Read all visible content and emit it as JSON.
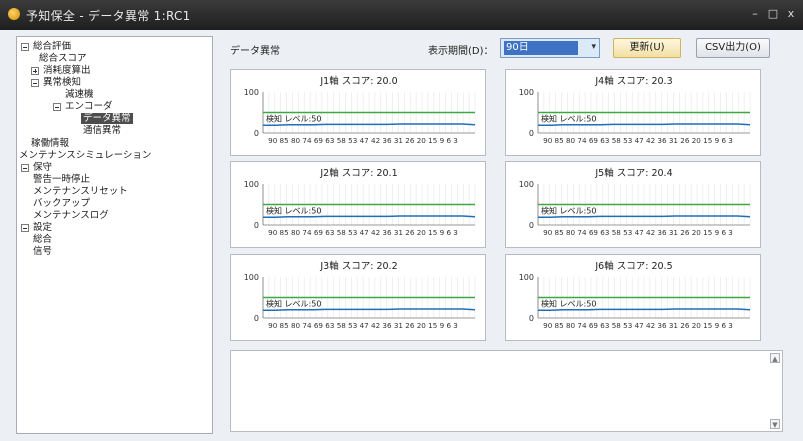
{
  "window": {
    "title": "予知保全 - データ異常 1:RC1",
    "minimize": "–",
    "maximize": "□",
    "close": "x"
  },
  "sidebar": {
    "items": [
      {
        "label": "総合評価",
        "toggle": "minus"
      },
      {
        "label": "総合スコア",
        "toggle": "none"
      },
      {
        "label": "消耗度算出",
        "toggle": "plus"
      },
      {
        "label": "異常検知",
        "toggle": "minus"
      },
      {
        "label": "減速機",
        "toggle": "none"
      },
      {
        "label": "エンコーダ",
        "toggle": "minus"
      },
      {
        "label": "データ異常",
        "toggle": "none",
        "selected": true
      },
      {
        "label": "通信異常",
        "toggle": "none"
      },
      {
        "label": "稼働情報",
        "toggle": "none"
      },
      {
        "label": "メンテナンスシミュレーション",
        "toggle": "none"
      },
      {
        "label": "保守",
        "toggle": "minus"
      },
      {
        "label": "警告一時停止",
        "toggle": "none"
      },
      {
        "label": "メンテナンスリセット",
        "toggle": "none"
      },
      {
        "label": "バックアップ",
        "toggle": "none"
      },
      {
        "label": "メンテナンスログ",
        "toggle": "none"
      },
      {
        "label": "設定",
        "toggle": "minus"
      },
      {
        "label": "総合",
        "toggle": "none"
      },
      {
        "label": "信号",
        "toggle": "none"
      }
    ]
  },
  "main": {
    "title": "データ異常",
    "period_label": "表示期間(D)：",
    "period_value": "90日",
    "update_button": "更新(U)",
    "csv_button": "CSV出力(O)"
  },
  "chart_data": [
    {
      "type": "line",
      "title": "J1軸 スコア: 20.0",
      "ylim": [
        0,
        100
      ],
      "y_ticks": [
        "100",
        "0"
      ],
      "x_tick_labels": "90 85 80 74 69 63 58 53 47 42 36 31 26 20 15  9 6 3",
      "threshold_label": "検知 レベル:50",
      "threshold": 50,
      "series_color": "#1f6fb7",
      "threshold_color": "#3aa845",
      "series": [
        {
          "values": [
            19,
            19,
            20,
            20,
            20,
            21,
            21,
            21,
            21,
            21,
            21,
            22,
            22,
            22,
            22,
            22,
            22,
            20
          ]
        }
      ]
    },
    {
      "type": "line",
      "title": "J4軸 スコア: 20.3",
      "ylim": [
        0,
        100
      ],
      "y_ticks": [
        "100",
        "0"
      ],
      "x_tick_labels": "90 85 80 74 69 63 58 53 47 42 36 31 26 20 15  9 6 3",
      "threshold_label": "検知 レベル:50",
      "threshold": 50,
      "series_color": "#1f6fb7",
      "threshold_color": "#3aa845",
      "series": [
        {
          "values": [
            19,
            19,
            20,
            20,
            20,
            20,
            21,
            21,
            21,
            21,
            21,
            22,
            22,
            22,
            22,
            22,
            22,
            20
          ]
        }
      ]
    },
    {
      "type": "line",
      "title": "J2軸 スコア: 20.1",
      "ylim": [
        0,
        100
      ],
      "y_ticks": [
        "100",
        "0"
      ],
      "x_tick_labels": "90 85 80 74 69 63 58 53 47 42 36 31 26 20 15  9 6 3",
      "threshold_label": "検知 レベル:50",
      "threshold": 50,
      "series_color": "#1f6fb7",
      "threshold_color": "#3aa845",
      "series": [
        {
          "values": [
            19,
            19,
            20,
            20,
            20,
            21,
            21,
            21,
            21,
            21,
            21,
            22,
            22,
            22,
            22,
            22,
            22,
            20
          ]
        }
      ]
    },
    {
      "type": "line",
      "title": "J5軸 スコア: 20.4",
      "ylim": [
        0,
        100
      ],
      "y_ticks": [
        "100",
        "0"
      ],
      "x_tick_labels": "90 85 80 74 69 63 58 53 47 42 36 31 26 20 15  9 6 3",
      "threshold_label": "検知 レベル:50",
      "threshold": 50,
      "series_color": "#1f6fb7",
      "threshold_color": "#3aa845",
      "series": [
        {
          "values": [
            19,
            19,
            20,
            20,
            20,
            21,
            21,
            21,
            21,
            21,
            21,
            22,
            22,
            22,
            22,
            22,
            22,
            20
          ]
        }
      ]
    },
    {
      "type": "line",
      "title": "J3軸 スコア: 20.2",
      "ylim": [
        0,
        100
      ],
      "y_ticks": [
        "100",
        "0"
      ],
      "x_tick_labels": "90 85 80 74 69 63 58 53 47 42 36 31 26 20 15  9 6 3",
      "threshold_label": "検知 レベル:50",
      "threshold": 50,
      "series_color": "#1f6fb7",
      "threshold_color": "#3aa845",
      "series": [
        {
          "values": [
            19,
            19,
            20,
            20,
            20,
            21,
            21,
            21,
            21,
            21,
            21,
            22,
            22,
            22,
            22,
            22,
            22,
            20
          ]
        }
      ]
    },
    {
      "type": "line",
      "title": "J6軸 スコア: 20.5",
      "ylim": [
        0,
        100
      ],
      "y_ticks": [
        "100",
        "0"
      ],
      "x_tick_labels": "90 85 80 74 69 63 58 53 47 42 36 31 26 20 15  9 6 3",
      "threshold_label": "検知 レベル:50",
      "threshold": 50,
      "series_color": "#1f6fb7",
      "threshold_color": "#3aa845",
      "series": [
        {
          "values": [
            19,
            19,
            20,
            20,
            20,
            21,
            21,
            21,
            21,
            21,
            21,
            22,
            22,
            22,
            22,
            22,
            22,
            20
          ]
        }
      ]
    }
  ],
  "log_area": {
    "scroll_up": "▲",
    "scroll_down": "▼"
  }
}
